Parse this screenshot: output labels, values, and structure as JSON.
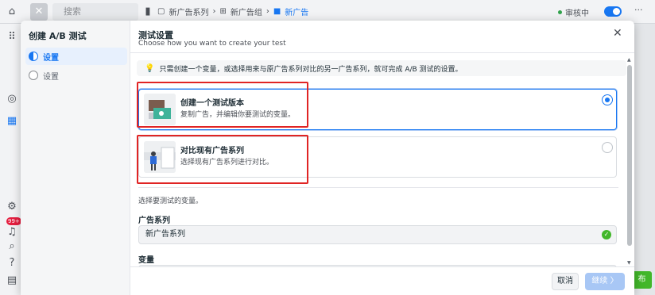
{
  "background": {
    "search_placeholder": "搜索",
    "breadcrumbs": [
      "新广告系列",
      "新广告组",
      "新广告"
    ],
    "status": "审核中",
    "more": "···",
    "publish_label": "布",
    "notification_count": "99+"
  },
  "modal": {
    "sidebar": {
      "title": "创建 A/B 测试",
      "steps": [
        {
          "label": "设置",
          "state": "active"
        },
        {
          "label": "设置",
          "state": "inactive"
        }
      ]
    },
    "header": {
      "title": "测试设置",
      "subtitle": "Choose how you want to create your test"
    },
    "info_banner": "只需创建一个变量，或选择用来与原广告系列对比的另一广告系列，就可完成 A/B 测试的设置。",
    "options": [
      {
        "title": "创建一个测试版本",
        "description": "复制广告，并编辑你要测试的变量。",
        "selected": true
      },
      {
        "title": "对比现有广告系列",
        "description": "选择现有广告系列进行对比。",
        "selected": false
      }
    ],
    "variable_hint": "选择要测试的变量。",
    "campaign_field": {
      "label": "广告系列",
      "value": "新广告系列"
    },
    "variable_field": {
      "label": "变量",
      "value": ""
    },
    "footer": {
      "cancel_label": "取消",
      "continue_label": "继续 〉"
    }
  },
  "colors": {
    "accent": "#1877f2",
    "highlight": "#e02424",
    "success": "#42b72a"
  }
}
